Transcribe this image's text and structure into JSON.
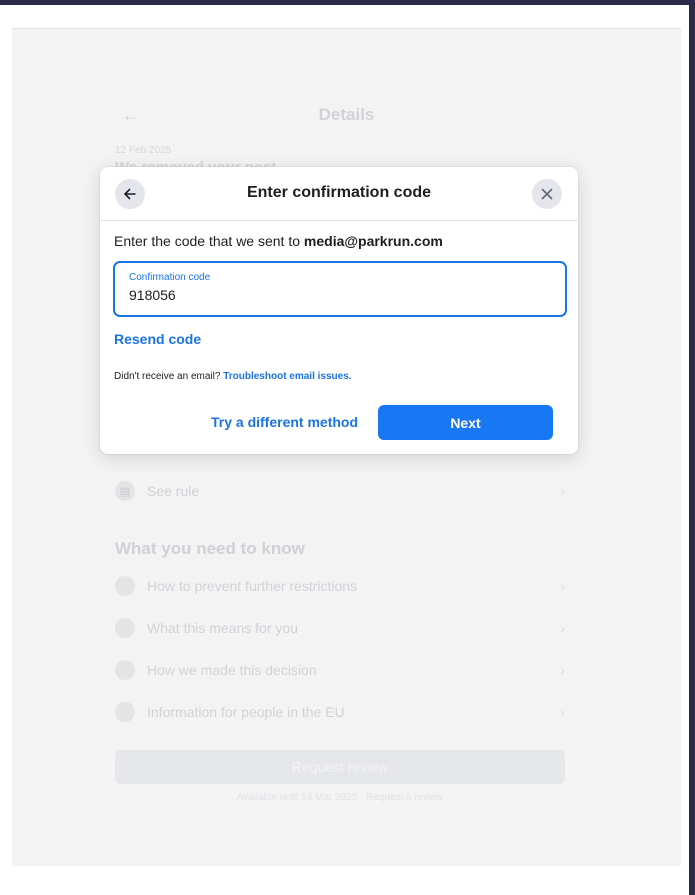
{
  "background": {
    "title": "Details",
    "date": "12 Feb 2025",
    "heading": "We removed your post",
    "rows_top": [
      "See rule"
    ],
    "section_title": "What you need to know",
    "rows": [
      "How to prevent further restrictions",
      "What this means for you",
      "How we made this decision",
      "Information for people in the EU"
    ],
    "request_button": "Request review",
    "footnote": "Available until 14 Mar 2025 · Request a review"
  },
  "modal": {
    "title": "Enter confirmation code",
    "intro_prefix": "Enter the code that we sent to ",
    "email": "media@parkrun.com",
    "field_label": "Confirmation code",
    "field_value": "918056",
    "resend_label": "Resend code",
    "help_prefix": "Didn't receive an email? ",
    "help_link": "Troubleshoot email issues.",
    "alt_method_label": "Try a different method",
    "next_label": "Next"
  },
  "colors": {
    "accent": "#1877f2",
    "link": "#1b74e4",
    "text": "#1c1e21"
  },
  "icons": {
    "back": "arrow-left-icon",
    "close": "close-icon"
  }
}
